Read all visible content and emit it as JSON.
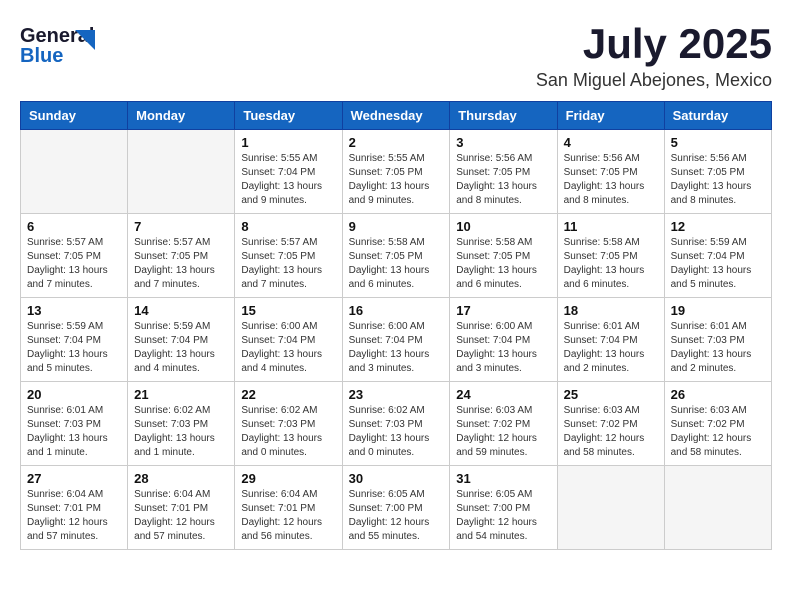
{
  "header": {
    "logo_general": "General",
    "logo_blue": "Blue",
    "title": "July 2025",
    "subtitle": "San Miguel Abejones, Mexico"
  },
  "days_of_week": [
    "Sunday",
    "Monday",
    "Tuesday",
    "Wednesday",
    "Thursday",
    "Friday",
    "Saturday"
  ],
  "weeks": [
    [
      {
        "day": "",
        "info": ""
      },
      {
        "day": "",
        "info": ""
      },
      {
        "day": "1",
        "info": "Sunrise: 5:55 AM\nSunset: 7:04 PM\nDaylight: 13 hours\nand 9 minutes."
      },
      {
        "day": "2",
        "info": "Sunrise: 5:55 AM\nSunset: 7:05 PM\nDaylight: 13 hours\nand 9 minutes."
      },
      {
        "day": "3",
        "info": "Sunrise: 5:56 AM\nSunset: 7:05 PM\nDaylight: 13 hours\nand 8 minutes."
      },
      {
        "day": "4",
        "info": "Sunrise: 5:56 AM\nSunset: 7:05 PM\nDaylight: 13 hours\nand 8 minutes."
      },
      {
        "day": "5",
        "info": "Sunrise: 5:56 AM\nSunset: 7:05 PM\nDaylight: 13 hours\nand 8 minutes."
      }
    ],
    [
      {
        "day": "6",
        "info": "Sunrise: 5:57 AM\nSunset: 7:05 PM\nDaylight: 13 hours\nand 7 minutes."
      },
      {
        "day": "7",
        "info": "Sunrise: 5:57 AM\nSunset: 7:05 PM\nDaylight: 13 hours\nand 7 minutes."
      },
      {
        "day": "8",
        "info": "Sunrise: 5:57 AM\nSunset: 7:05 PM\nDaylight: 13 hours\nand 7 minutes."
      },
      {
        "day": "9",
        "info": "Sunrise: 5:58 AM\nSunset: 7:05 PM\nDaylight: 13 hours\nand 6 minutes."
      },
      {
        "day": "10",
        "info": "Sunrise: 5:58 AM\nSunset: 7:05 PM\nDaylight: 13 hours\nand 6 minutes."
      },
      {
        "day": "11",
        "info": "Sunrise: 5:58 AM\nSunset: 7:05 PM\nDaylight: 13 hours\nand 6 minutes."
      },
      {
        "day": "12",
        "info": "Sunrise: 5:59 AM\nSunset: 7:04 PM\nDaylight: 13 hours\nand 5 minutes."
      }
    ],
    [
      {
        "day": "13",
        "info": "Sunrise: 5:59 AM\nSunset: 7:04 PM\nDaylight: 13 hours\nand 5 minutes."
      },
      {
        "day": "14",
        "info": "Sunrise: 5:59 AM\nSunset: 7:04 PM\nDaylight: 13 hours\nand 4 minutes."
      },
      {
        "day": "15",
        "info": "Sunrise: 6:00 AM\nSunset: 7:04 PM\nDaylight: 13 hours\nand 4 minutes."
      },
      {
        "day": "16",
        "info": "Sunrise: 6:00 AM\nSunset: 7:04 PM\nDaylight: 13 hours\nand 3 minutes."
      },
      {
        "day": "17",
        "info": "Sunrise: 6:00 AM\nSunset: 7:04 PM\nDaylight: 13 hours\nand 3 minutes."
      },
      {
        "day": "18",
        "info": "Sunrise: 6:01 AM\nSunset: 7:04 PM\nDaylight: 13 hours\nand 2 minutes."
      },
      {
        "day": "19",
        "info": "Sunrise: 6:01 AM\nSunset: 7:03 PM\nDaylight: 13 hours\nand 2 minutes."
      }
    ],
    [
      {
        "day": "20",
        "info": "Sunrise: 6:01 AM\nSunset: 7:03 PM\nDaylight: 13 hours\nand 1 minute."
      },
      {
        "day": "21",
        "info": "Sunrise: 6:02 AM\nSunset: 7:03 PM\nDaylight: 13 hours\nand 1 minute."
      },
      {
        "day": "22",
        "info": "Sunrise: 6:02 AM\nSunset: 7:03 PM\nDaylight: 13 hours\nand 0 minutes."
      },
      {
        "day": "23",
        "info": "Sunrise: 6:02 AM\nSunset: 7:03 PM\nDaylight: 13 hours\nand 0 minutes."
      },
      {
        "day": "24",
        "info": "Sunrise: 6:03 AM\nSunset: 7:02 PM\nDaylight: 12 hours\nand 59 minutes."
      },
      {
        "day": "25",
        "info": "Sunrise: 6:03 AM\nSunset: 7:02 PM\nDaylight: 12 hours\nand 58 minutes."
      },
      {
        "day": "26",
        "info": "Sunrise: 6:03 AM\nSunset: 7:02 PM\nDaylight: 12 hours\nand 58 minutes."
      }
    ],
    [
      {
        "day": "27",
        "info": "Sunrise: 6:04 AM\nSunset: 7:01 PM\nDaylight: 12 hours\nand 57 minutes."
      },
      {
        "day": "28",
        "info": "Sunrise: 6:04 AM\nSunset: 7:01 PM\nDaylight: 12 hours\nand 57 minutes."
      },
      {
        "day": "29",
        "info": "Sunrise: 6:04 AM\nSunset: 7:01 PM\nDaylight: 12 hours\nand 56 minutes."
      },
      {
        "day": "30",
        "info": "Sunrise: 6:05 AM\nSunset: 7:00 PM\nDaylight: 12 hours\nand 55 minutes."
      },
      {
        "day": "31",
        "info": "Sunrise: 6:05 AM\nSunset: 7:00 PM\nDaylight: 12 hours\nand 54 minutes."
      },
      {
        "day": "",
        "info": ""
      },
      {
        "day": "",
        "info": ""
      }
    ]
  ]
}
